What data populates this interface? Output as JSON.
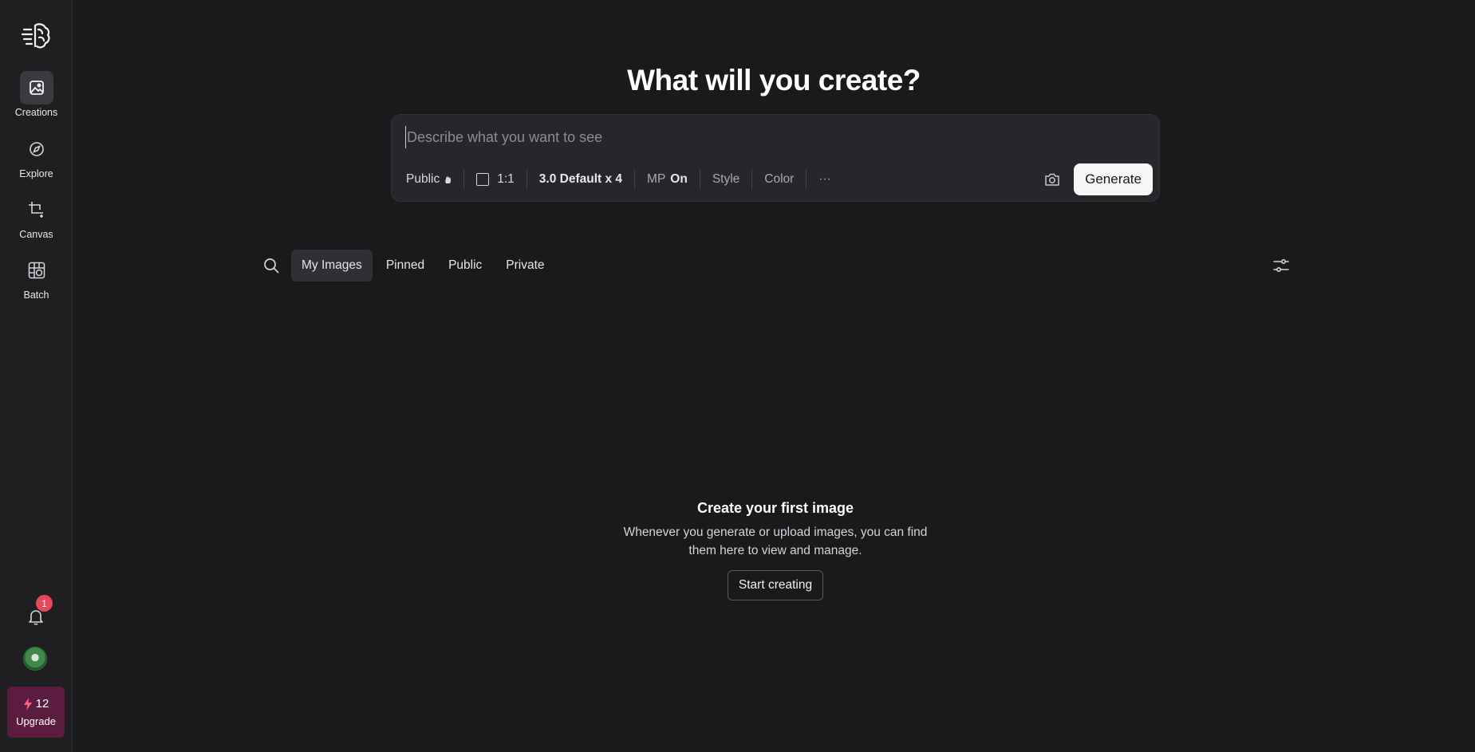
{
  "sidebar": {
    "logo_icon": "brain-logo-icon",
    "items": [
      {
        "label": "Creations",
        "icon": "image-icon",
        "active": true
      },
      {
        "label": "Explore",
        "icon": "compass-icon",
        "active": false
      },
      {
        "label": "Canvas",
        "icon": "crop-sparkle-icon",
        "active": false
      },
      {
        "label": "Batch",
        "icon": "grid-image-icon",
        "active": false
      }
    ],
    "notifications_count": "1",
    "credits": "12",
    "upgrade_label": "Upgrade"
  },
  "main": {
    "headline": "What will you create?",
    "prompt": {
      "placeholder": "Describe what you want to see",
      "value": ""
    },
    "toolbar": {
      "visibility": "Public",
      "aspect_ratio": "1:1",
      "model": "3.0 Default x 4",
      "mp_label": "MP",
      "mp_value": "On",
      "style": "Style",
      "color": "Color",
      "more": "···",
      "generate_label": "Generate"
    },
    "tabs": [
      {
        "label": "My Images",
        "active": true
      },
      {
        "label": "Pinned",
        "active": false
      },
      {
        "label": "Public",
        "active": false
      },
      {
        "label": "Private",
        "active": false
      }
    ],
    "empty_state": {
      "title": "Create your first image",
      "description": "Whenever you generate or upload images, you can find them here to view and manage.",
      "button": "Start creating"
    }
  },
  "colors": {
    "background": "#1a1a1d",
    "sidebar": "#1f1f22",
    "upgrade": "#5b1d3f",
    "badge": "#e5485d"
  }
}
